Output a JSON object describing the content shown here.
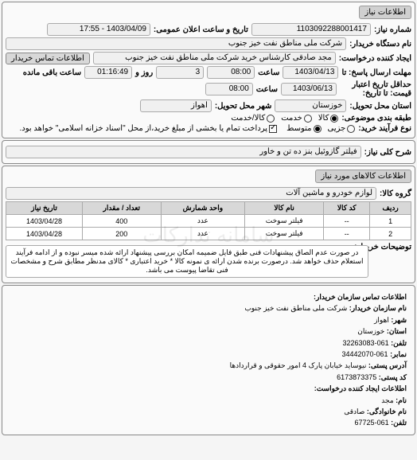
{
  "panel1": {
    "title": "اطلاعات نیاز",
    "request_no_label": "شماره نیاز:",
    "request_no": "1103092288001417",
    "announce_label": "تاریخ و ساعت اعلان عمومی:",
    "announce": "1403/04/09 - 17:55",
    "buyer_org_label": "نام دستگاه خریدار:",
    "buyer_org": "شرکت ملی مناطق نفت خیز جنوب",
    "creator_label": "ایجاد کننده درخواست:",
    "creator": "مجد صادقی  کارشناس خرید  شرکت ملی مناطق نفت خیز جنوب",
    "contact_btn": "اطلاعات تماس خریدار",
    "deadline_label": "مهلت ارسال پاسخ: تا",
    "deadline_date": "1403/04/13",
    "time_label": "ساعت",
    "deadline_time": "08:00",
    "days_label": "روز و",
    "days": "3",
    "remain_label": "ساعت باقی مانده",
    "remain": "01:16:49",
    "validity_label": "حداقل تاریخ اعتبار",
    "validity_label2": "قیمت: تا تاریخ:",
    "validity_date": "1403/06/13",
    "validity_time": "08:00",
    "state_label": "استان محل تحویل:",
    "state": "خوزستان",
    "city_label": "شهر محل تحویل:",
    "city": "اهواز",
    "pkg_label": "طبقه بندی موضوعی:",
    "pkg_all": "کالا",
    "pkg_service": "خدمت",
    "pkg_both": "کالا/خدمت",
    "process_label": "نوع فرآیند خرید:",
    "proc_partial": "جزیی",
    "proc_medium": "متوسط",
    "proc_note": "پرداخت تمام یا بخشی از مبلغ خرید،از محل \"اسناد خزانه اسلامی\" خواهد بود."
  },
  "panel2": {
    "title_label": "شرح کلی نیاز:",
    "title": "فیلتر گازوئیل بنز ده تن و خاور"
  },
  "panel3": {
    "title": "اطلاعات کالاهای مورد نیاز",
    "group_label": "گروه کالا:",
    "group": "لوازم خودرو و ماشین آلات",
    "headers": [
      "ردیف",
      "کد کالا",
      "نام کالا",
      "واحد شمارش",
      "تعداد / مقدار",
      "تاریخ نیاز"
    ],
    "rows": [
      [
        "1",
        "--",
        "فیلتر سوخت",
        "عدد",
        "400",
        "1403/04/28"
      ],
      [
        "2",
        "--",
        "فیلتر سوخت",
        "عدد",
        "200",
        "1403/04/28"
      ]
    ],
    "note_label": "توضیحات خریدار:",
    "note": "در صورت عدم الصاق پیشنهادات فنی طبق فایل ضمیمه امکان بررسی پیشنهاد ارائه شده میسر نبوده و از ادامه فرآیند استعلام حذف خواهد شد. درصورت برنده شدن ارائه ی نمونه کالا * خرید اعتباری * کالای مدنظر مطابق شرح و مشخصات فنی تقاضا پیوست می باشد."
  },
  "panel4": {
    "title": "اطلاعات تماس سازمان خریدار:",
    "org_label": "نام سازمان خریدار:",
    "org": "شرکت ملی مناطق نفت خیز جنوب",
    "city_label": "شهر:",
    "city": "اهواز",
    "province_label": "استان:",
    "province": "خوزستان",
    "phone_label": "تلفن:",
    "phone": "061-32263083",
    "fax_label": "نمابر:",
    "fax": "061-34442070",
    "address_label": "آدرس پستی:",
    "address": "نیوساید خیابان پارک 4 امور حقوقی و قراردادها",
    "postal_label": "کد پستی:",
    "postal": "6173873375",
    "creator_label": "اطلاعات ایجاد کننده درخواست:",
    "name_label": "نام:",
    "name": "مجد",
    "family_label": "نام خانوادگی:",
    "family": "صادقی",
    "tel_label": "تلفن:",
    "tel": "061-67725"
  },
  "watermark": "سامانه تدارکات"
}
